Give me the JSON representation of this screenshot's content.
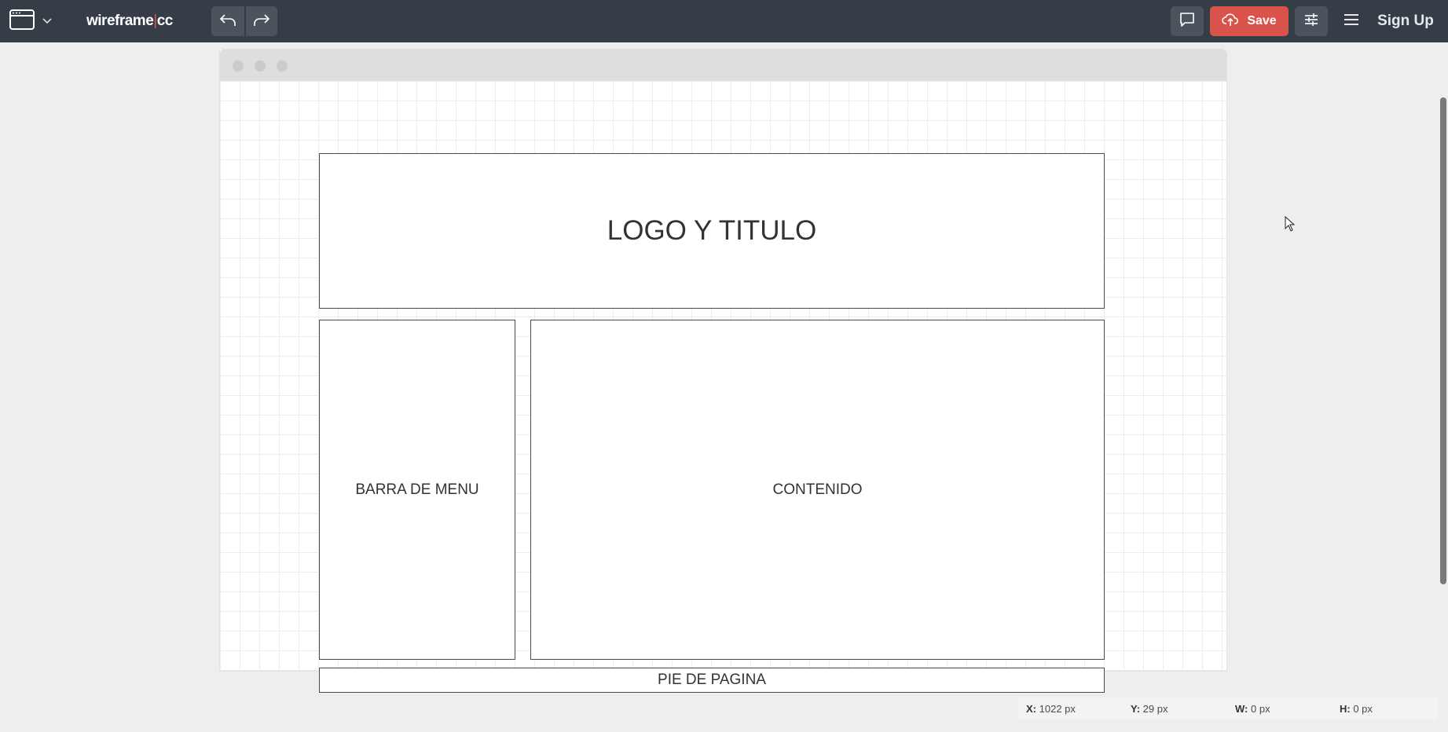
{
  "topbar": {
    "brand_left": "wireframe",
    "brand_sep": "|",
    "brand_right": "cc",
    "save_label": "Save",
    "signup_label": "Sign Up",
    "icons": {
      "browser": "browser-window-icon",
      "chevron": "chevron-down-icon",
      "undo": "undo-icon",
      "redo": "redo-icon",
      "comment": "comment-icon",
      "upload": "cloud-upload-icon",
      "settings": "sliders-icon",
      "menu": "hamburger-icon"
    }
  },
  "canvas": {
    "boxes": {
      "header": "LOGO Y TITULO",
      "menu": "BARRA DE MENU",
      "content": "CONTENIDO",
      "footer": "PIE DE PAGINA"
    }
  },
  "status": {
    "x_label": "X:",
    "x_value": "1022 px",
    "y_label": "Y:",
    "y_value": "29 px",
    "w_label": "W:",
    "w_value": "0 px",
    "h_label": "H:",
    "h_value": "0 px"
  },
  "colors": {
    "topbar": "#353d47",
    "save": "#d9534a",
    "accent": "#e05a47"
  }
}
